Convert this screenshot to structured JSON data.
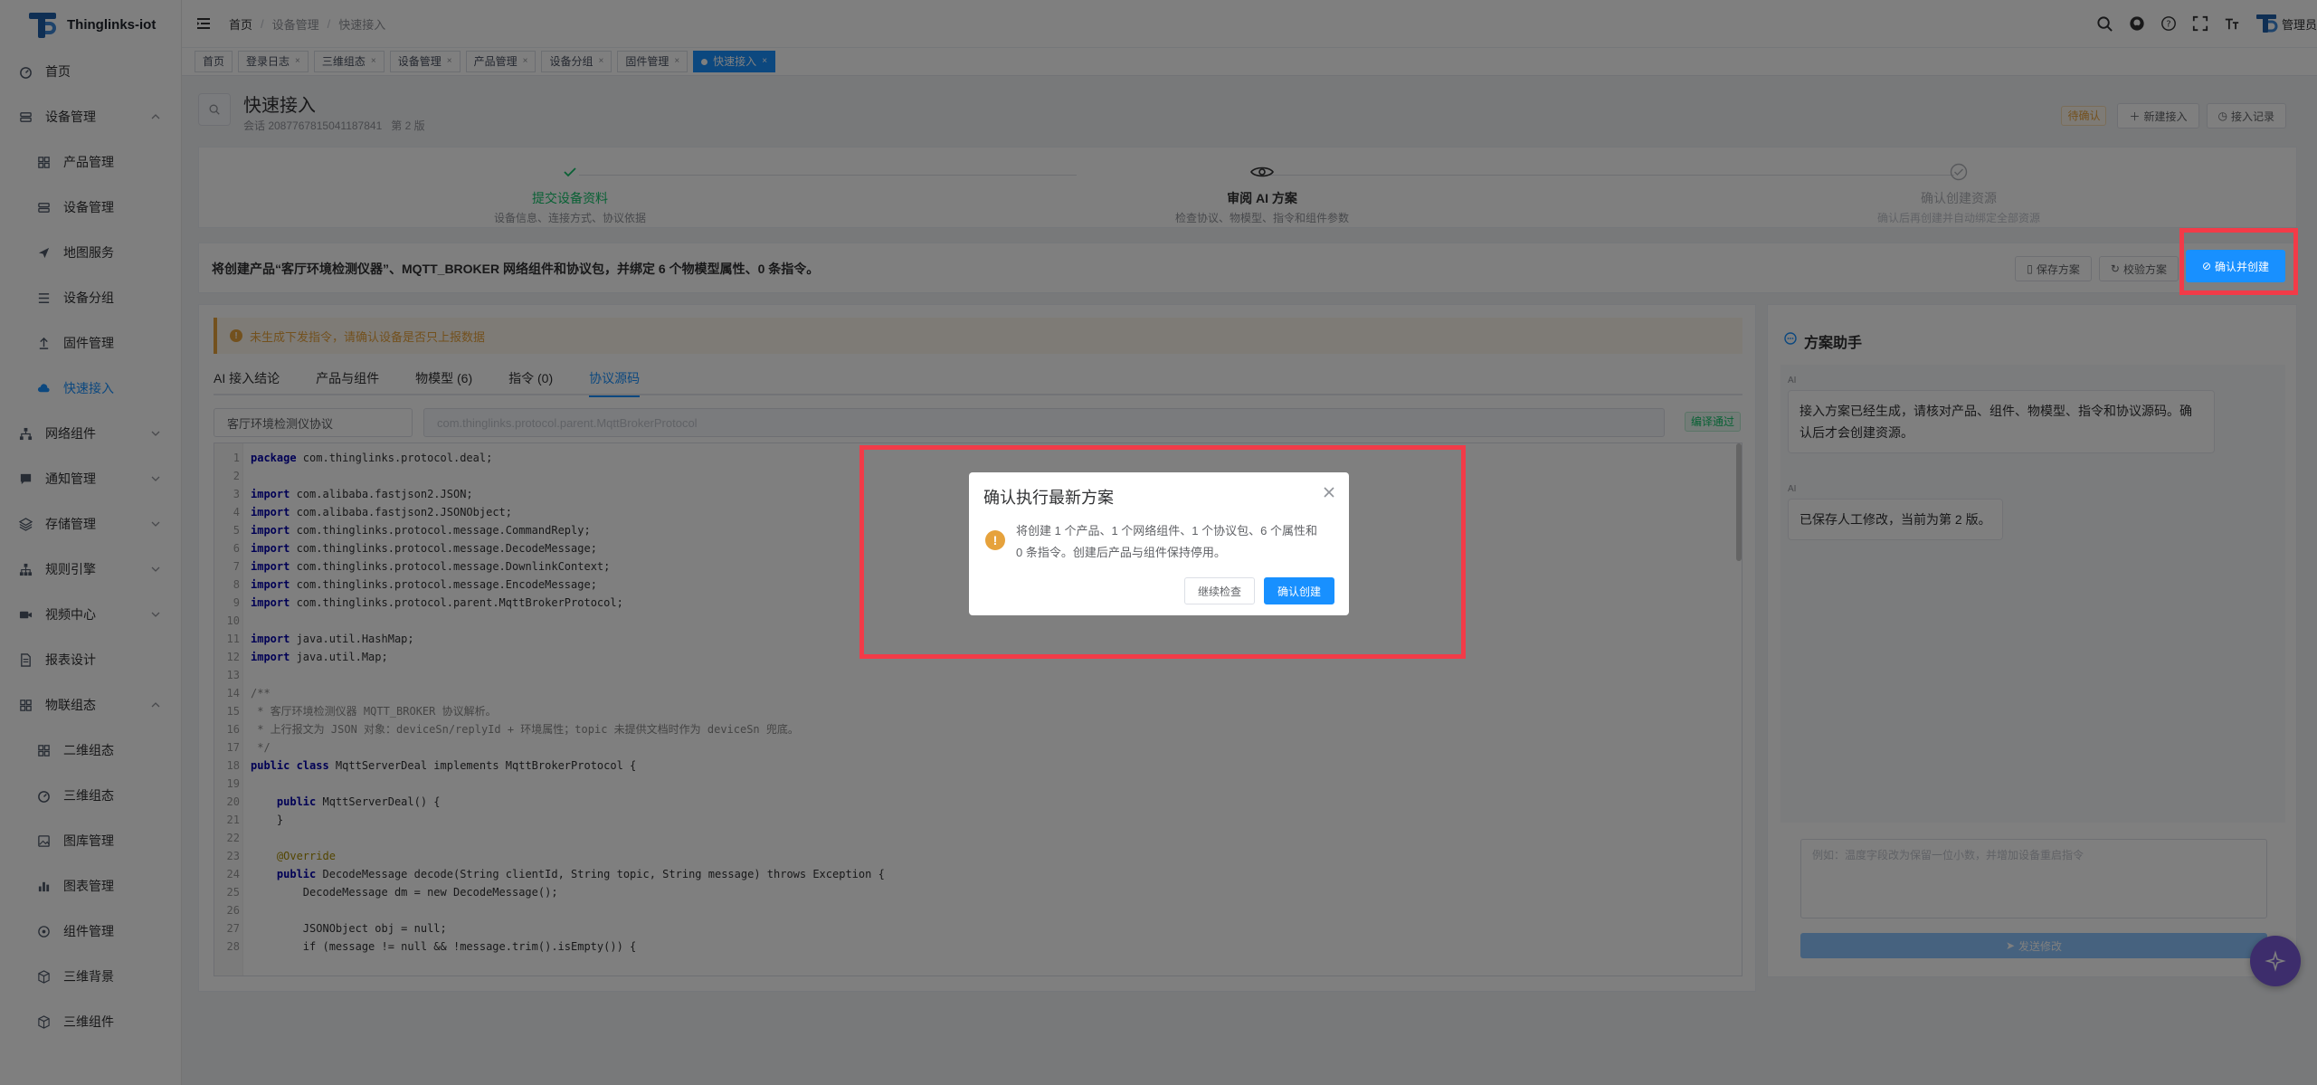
{
  "app": {
    "name": "Thinglinks-iot",
    "user": "管理员"
  },
  "sidebar": {
    "items": [
      {
        "label": "首页",
        "level": "top",
        "icon": "dashboard-icon"
      },
      {
        "label": "设备管理",
        "level": "top",
        "icon": "device-icon",
        "expandable": true,
        "expanded": true
      },
      {
        "label": "产品管理",
        "level": "sub",
        "icon": "grid-icon"
      },
      {
        "label": "设备管理",
        "level": "sub",
        "icon": "device-icon"
      },
      {
        "label": "地图服务",
        "level": "sub",
        "icon": "send-icon"
      },
      {
        "label": "设备分组",
        "level": "sub",
        "icon": "list-icon"
      },
      {
        "label": "固件管理",
        "level": "sub",
        "icon": "upload-icon"
      },
      {
        "label": "快速接入",
        "level": "sub",
        "icon": "cloud-icon",
        "active": true
      },
      {
        "label": "网络组件",
        "level": "top",
        "icon": "network-icon",
        "expandable": true
      },
      {
        "label": "通知管理",
        "level": "top",
        "icon": "message-icon",
        "expandable": true
      },
      {
        "label": "存储管理",
        "level": "top",
        "icon": "storage-icon",
        "expandable": true
      },
      {
        "label": "规则引擎",
        "level": "top",
        "icon": "rule-icon",
        "expandable": true
      },
      {
        "label": "视频中心",
        "level": "top",
        "icon": "video-icon",
        "expandable": true
      },
      {
        "label": "报表设计",
        "level": "top",
        "icon": "report-icon"
      },
      {
        "label": "物联组态",
        "level": "top",
        "icon": "grid-icon",
        "expandable": true,
        "expanded": true
      },
      {
        "label": "二维组态",
        "level": "sub",
        "icon": "grid-icon"
      },
      {
        "label": "三维组态",
        "level": "sub",
        "icon": "dashboard-icon"
      },
      {
        "label": "图库管理",
        "level": "sub",
        "icon": "image-icon"
      },
      {
        "label": "图表管理",
        "level": "sub",
        "icon": "chart-icon"
      },
      {
        "label": "组件管理",
        "level": "sub",
        "icon": "component-icon"
      },
      {
        "label": "三维背景",
        "level": "sub",
        "icon": "cube-icon"
      },
      {
        "label": "三维组件",
        "level": "sub",
        "icon": "cube-icon"
      }
    ]
  },
  "header": {
    "breadcrumb": [
      "首页",
      "设备管理",
      "快速接入"
    ]
  },
  "tags": [
    {
      "label": "首页",
      "closable": false
    },
    {
      "label": "登录日志",
      "closable": true
    },
    {
      "label": "三维组态",
      "closable": true
    },
    {
      "label": "设备管理",
      "closable": true
    },
    {
      "label": "产品管理",
      "closable": true
    },
    {
      "label": "设备分组",
      "closable": true
    },
    {
      "label": "固件管理",
      "closable": true
    },
    {
      "label": "快速接入",
      "closable": true,
      "active": true
    }
  ],
  "page": {
    "title": "快速接入",
    "session": "会话 2087767815041187841",
    "version": "第 2 版",
    "status_badge": "待确认",
    "new_access": "新建接入",
    "access_history": "接入记录"
  },
  "steps": [
    {
      "title": "提交设备资料",
      "desc": "设备信息、连接方式、协议依据",
      "state": "done"
    },
    {
      "title": "审阅 AI 方案",
      "desc": "检查协议、物模型、指令和组件参数",
      "state": "current"
    },
    {
      "title": "确认创建资源",
      "desc": "确认后再创建并自动绑定全部资源",
      "state": "wait"
    }
  ],
  "summary": {
    "text": "将创建产品“客厅环境检测仪器”、MQTT_BROKER 网络组件和协议包，并绑定 6 个物模型属性、0 条指令。",
    "save_plan": "保存方案",
    "verify_plan": "校验方案",
    "confirm_create": "确认并创建"
  },
  "main": {
    "alert": "未生成下发指令，请确认设备是否只上报数据",
    "tabs": [
      "AI 接入结论",
      "产品与组件",
      "物模型 (6)",
      "指令 (0)",
      "协议源码"
    ],
    "protocol_name": "客厅环境检测仪协议",
    "protocol_class": "com.thinglinks.protocol.parent.MqttBrokerProtocol",
    "compile_status": "编译通过",
    "code": [
      {
        "n": "1",
        "t": "package com.thinglinks.protocol.deal;"
      },
      {
        "n": "2",
        "t": ""
      },
      {
        "n": "3",
        "t": "import com.alibaba.fastjson2.JSON;"
      },
      {
        "n": "4",
        "t": "import com.alibaba.fastjson2.JSONObject;"
      },
      {
        "n": "5",
        "t": "import com.thinglinks.protocol.message.CommandReply;"
      },
      {
        "n": "6",
        "t": "import com.thinglinks.protocol.message.DecodeMessage;"
      },
      {
        "n": "7",
        "t": "import com.thinglinks.protocol.message.DownlinkContext;"
      },
      {
        "n": "8",
        "t": "import com.thinglinks.protocol.message.EncodeMessage;"
      },
      {
        "n": "9",
        "t": "import com.thinglinks.protocol.parent.MqttBrokerProtocol;"
      },
      {
        "n": "10",
        "t": ""
      },
      {
        "n": "11",
        "t": "import java.util.HashMap;"
      },
      {
        "n": "12",
        "t": "import java.util.Map;"
      },
      {
        "n": "13",
        "t": ""
      },
      {
        "n": "14",
        "t": "/**"
      },
      {
        "n": "15",
        "t": " * 客厅环境检测仪器 MQTT_BROKER 协议解析。"
      },
      {
        "n": "16",
        "t": " * 上行报文为 JSON 对象：deviceSn/replyId + 环境属性；topic 未提供文档时作为 deviceSn 兜底。"
      },
      {
        "n": "17",
        "t": " */"
      },
      {
        "n": "18",
        "t": "public class MqttServerDeal implements MqttBrokerProtocol {"
      },
      {
        "n": "19",
        "t": ""
      },
      {
        "n": "20",
        "t": "    public MqttServerDeal() {"
      },
      {
        "n": "21",
        "t": "    }"
      },
      {
        "n": "22",
        "t": ""
      },
      {
        "n": "23",
        "t": "    @Override"
      },
      {
        "n": "24",
        "t": "    public DecodeMessage decode(String clientId, String topic, String message) throws Exception {"
      },
      {
        "n": "25",
        "t": "        DecodeMessage dm = new DecodeMessage();"
      },
      {
        "n": "26",
        "t": ""
      },
      {
        "n": "27",
        "t": "        JSONObject obj = null;"
      },
      {
        "n": "28",
        "t": "        if (message != null && !message.trim().isEmpty()) {"
      }
    ]
  },
  "assistant": {
    "title": "方案助手",
    "role_label": "AI",
    "msg1": "接入方案已经生成，请核对产品、组件、物模型、指令和协议源码。确认后才会创建资源。",
    "msg2": "已保存人工修改，当前为第 2 版。",
    "input_placeholder": "例如：温度字段改为保留一位小数，并增加设备重启指令",
    "send": "发送修改"
  },
  "dialog": {
    "title": "确认执行最新方案",
    "message": "将创建 1 个产品、1 个网络组件、1 个协议包、6 个属性和 0 条指令。创建后产品与组件保持停用。",
    "cancel": "继续检查",
    "confirm": "确认创建"
  },
  "colors": {
    "primary": "#1890ff",
    "highlight": "#f23b48",
    "warning": "#e6a23c",
    "success": "#13c26a"
  }
}
